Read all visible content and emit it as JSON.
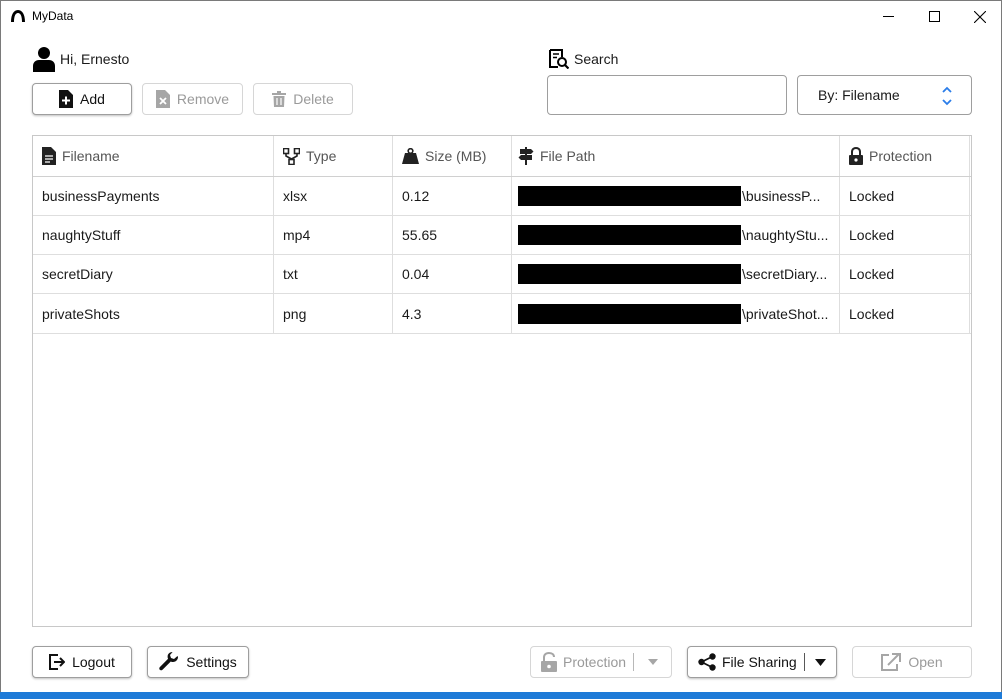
{
  "window": {
    "title": "MyData",
    "controls": [
      "minimize-icon",
      "maximize-icon",
      "close-icon"
    ]
  },
  "user": {
    "greeting": "Hi, Ernesto"
  },
  "toolbar": {
    "add_label": "Add",
    "remove_label": "Remove",
    "delete_label": "Delete"
  },
  "search": {
    "label": "Search",
    "value": "",
    "placeholder": "",
    "sort_by": "By: Filename"
  },
  "table": {
    "columns": [
      {
        "label": "Filename",
        "icon": "file-icon"
      },
      {
        "label": "Type",
        "icon": "branch-icon"
      },
      {
        "label": "Size (MB)",
        "icon": "weight-icon"
      },
      {
        "label": "File Path",
        "icon": "signpost-icon"
      },
      {
        "label": "Protection",
        "icon": "lock-icon"
      }
    ],
    "rows": [
      {
        "filename": "businessPayments",
        "type": "xlsx",
        "size": "0.12",
        "path": "\\businessP...",
        "protection": "Locked"
      },
      {
        "filename": "naughtyStuff",
        "type": "mp4",
        "size": "55.65",
        "path": "\\naughtyStu...",
        "protection": "Locked"
      },
      {
        "filename": "secretDiary",
        "type": "txt",
        "size": "0.04",
        "path": "\\secretDiary...",
        "protection": "Locked"
      },
      {
        "filename": "privateShots",
        "type": "png",
        "size": "4.3",
        "path": "\\privateShot...",
        "protection": "Locked"
      }
    ]
  },
  "footer": {
    "logout_label": "Logout",
    "settings_label": "Settings",
    "protection_label": "Protection",
    "sharing_label": "File Sharing",
    "open_label": "Open"
  },
  "colors": {
    "taskbar": "#1e7bd8",
    "select_chevron": "#2b7de9",
    "disabled_text": "#9a9a9a"
  }
}
